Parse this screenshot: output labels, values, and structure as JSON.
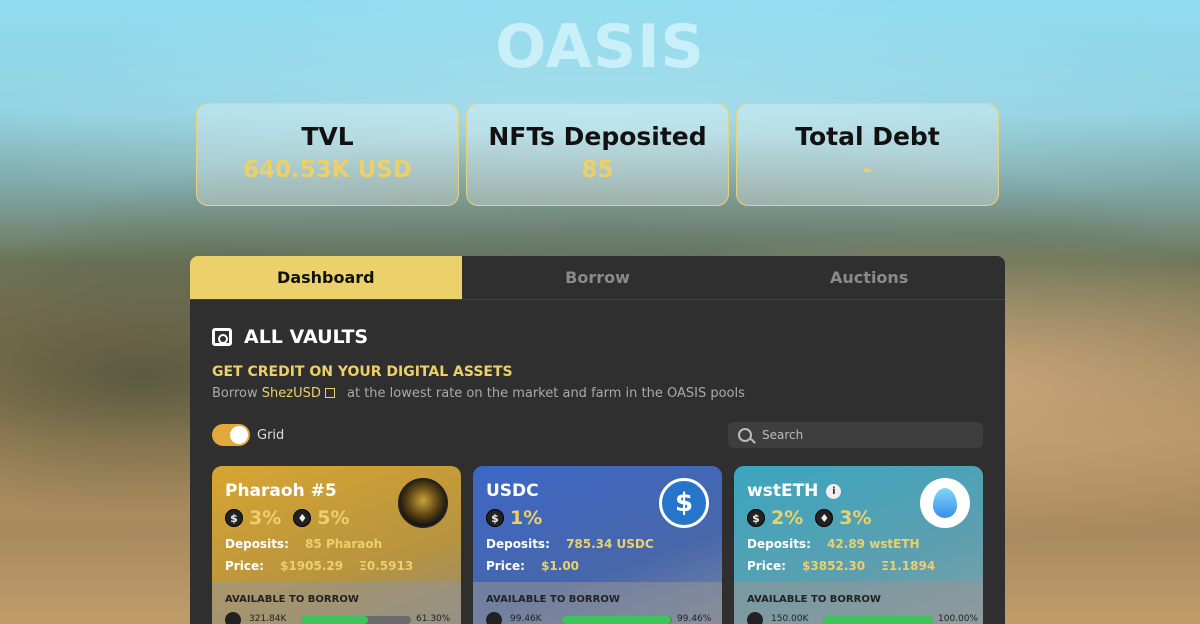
{
  "app": {
    "logo": "OASIS"
  },
  "stats": [
    {
      "label": "TVL",
      "value": "640.53K USD"
    },
    {
      "label": "NFTs Deposited",
      "value": "85"
    },
    {
      "label": "Total Debt",
      "value": "-"
    }
  ],
  "tabs": [
    {
      "label": "Dashboard",
      "active": true
    },
    {
      "label": "Borrow",
      "active": false
    },
    {
      "label": "Auctions",
      "active": false
    }
  ],
  "vaults": {
    "title": "ALL VAULTS",
    "credit_title": "GET CREDIT ON YOUR DIGITAL ASSETS",
    "credit_prefix": "Borrow",
    "credit_link": "ShezUSD",
    "credit_suffix": "at the lowest rate on the market and farm in the OASIS pools",
    "toggle_label": "Grid",
    "toggle_on": true,
    "search_placeholder": "Search"
  },
  "cards": [
    {
      "name": "Pharaoh #5",
      "rate1": "3%",
      "rate2": "5%",
      "deposits_label": "Deposits:",
      "deposits_value": "85 Pharaoh",
      "price_label": "Price:",
      "price_usd": "$1905.29",
      "price_eth": "Ξ0.5913",
      "available_label": "AVAILABLE TO BORROW",
      "available_amount": "321.84K",
      "available_pct": "61.30%",
      "available_fraction": 0.613
    },
    {
      "name": "USDC",
      "rate1": "1%",
      "deposits_label": "Deposits:",
      "deposits_value": "785.34 USDC",
      "price_label": "Price:",
      "price_usd": "$1.00",
      "available_label": "AVAILABLE TO BORROW",
      "available_amount": "99.46K",
      "available_pct": "99.46%",
      "available_fraction": 0.9946
    },
    {
      "name": "wstETH",
      "rate1": "2%",
      "rate2": "3%",
      "deposits_label": "Deposits:",
      "deposits_value": "42.89 wstETH",
      "price_label": "Price:",
      "price_usd": "$3852.30",
      "price_eth": "Ξ1.1894",
      "available_label": "AVAILABLE TO BORROW",
      "available_amount": "150.00K",
      "available_pct": "100.00%",
      "available_fraction": 1.0
    }
  ],
  "colors": {
    "accent": "#ecd06a",
    "panel": "#2f2f2f",
    "progress": "#3dc45a"
  }
}
